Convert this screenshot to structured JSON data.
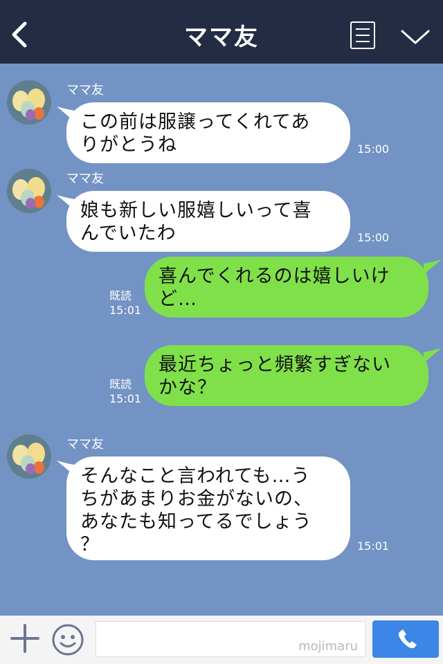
{
  "header": {
    "title": "ママ友",
    "back_icon": "chevron-left-icon",
    "menu_icon": "list-icon",
    "expand_icon": "chevron-down-icon",
    "background_color": "#242c43"
  },
  "chat": {
    "background_color": "#7293c4",
    "messages": [
      {
        "direction": "incoming",
        "sender": "ママ友",
        "text_lines": [
          "この前は服譲ってくれてあ",
          "りがとうね"
        ],
        "time": "15:00"
      },
      {
        "direction": "incoming",
        "sender": "ママ友",
        "text_lines": [
          "娘も新しい服嬉しいって喜",
          "んでいたわ"
        ],
        "time": "15:00"
      },
      {
        "direction": "outgoing",
        "read_label": "既読",
        "text_lines": [
          "喜んでくれるのは嬉しいけ",
          "ど…"
        ],
        "time": "15:01"
      },
      {
        "direction": "outgoing",
        "read_label": "既読",
        "text_lines": [
          "最近ちょっと頻繁すぎない",
          "かな？"
        ],
        "time": "15:01"
      },
      {
        "direction": "incoming",
        "sender": "ママ友",
        "text_lines": [
          "そんなこと言われても…う",
          "ちがあまりお金がないの、",
          "あなたも知ってるでしょう",
          "？"
        ],
        "time": "15:01"
      }
    ]
  },
  "footer": {
    "plus_icon": "plus-icon",
    "emoji_icon": "smiley-icon",
    "input_value": "",
    "watermark": "mojimaru",
    "call_icon": "phone-icon",
    "call_color": "#3b86e6"
  },
  "colors": {
    "incoming_bubble": "#ffffff",
    "outgoing_bubble": "#80e04a"
  }
}
